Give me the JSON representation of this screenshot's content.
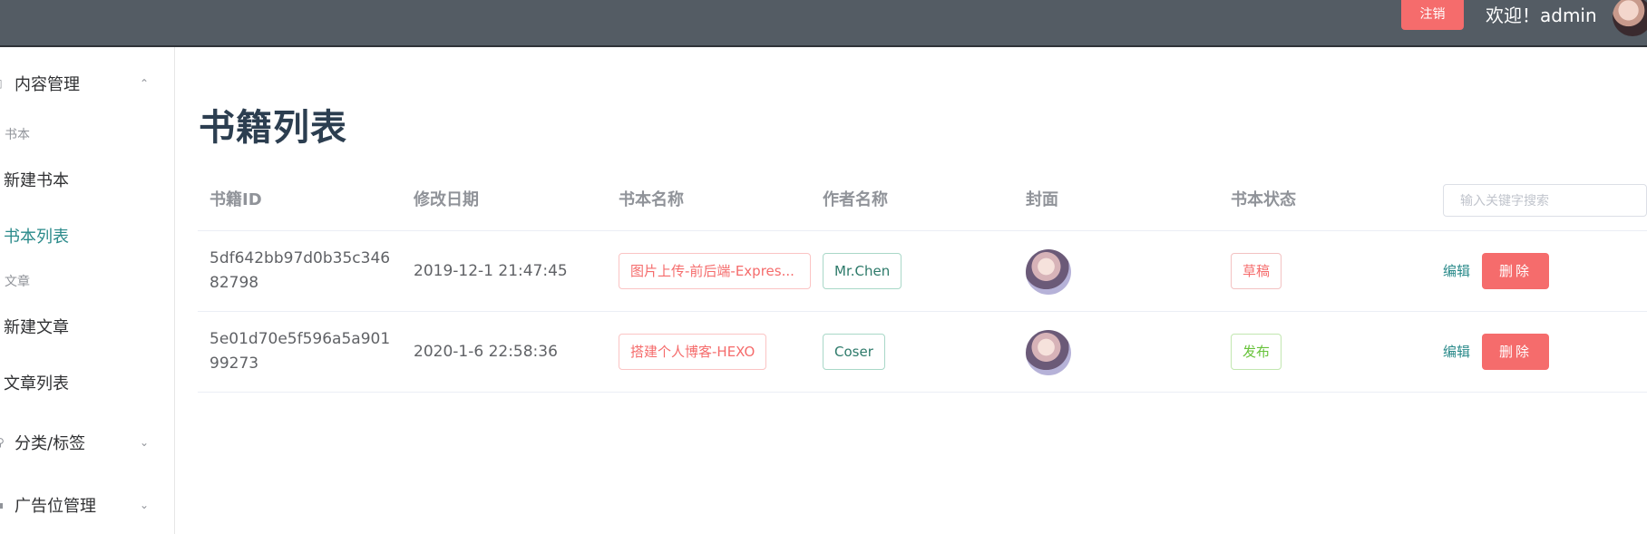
{
  "header": {
    "logout_label": "注销",
    "welcome_text": "欢迎！admin"
  },
  "sidebar": {
    "groups": [
      {
        "label": "内容管理",
        "chevron": "up"
      },
      {
        "label": "分类/标签",
        "chevron": "down"
      },
      {
        "label": "广告位管理",
        "chevron": "down"
      }
    ],
    "sections": [
      {
        "title": "书本",
        "items": [
          "新建书本",
          "书本列表"
        ]
      },
      {
        "title": "文章",
        "items": [
          "新建文章",
          "文章列表"
        ]
      }
    ],
    "active_item": "书本列表"
  },
  "main": {
    "title": "书籍列表",
    "columns": [
      "书籍ID",
      "修改日期",
      "书本名称",
      "作者名称",
      "封面",
      "书本状态"
    ],
    "search_placeholder": "输入关键字搜索",
    "edit_label": "编辑",
    "delete_label": "删除",
    "rows": [
      {
        "id": "5df642bb97d0b35c34682798",
        "date": "2019-12-1 21:47:45",
        "name": "图片上传-前后端-Expres...",
        "author": "Mr.Chen",
        "status": "草稿"
      },
      {
        "id": "5e01d70e5f596a5a90199273",
        "date": "2020-1-6 22:58:36",
        "name": "搭建个人博客-HEXO",
        "author": "Coser",
        "status": "发布"
      }
    ]
  },
  "colors": {
    "topbar": "#545c64",
    "danger": "#f56c6c",
    "accent": "#2a8a8a",
    "success": "#67c23a"
  }
}
